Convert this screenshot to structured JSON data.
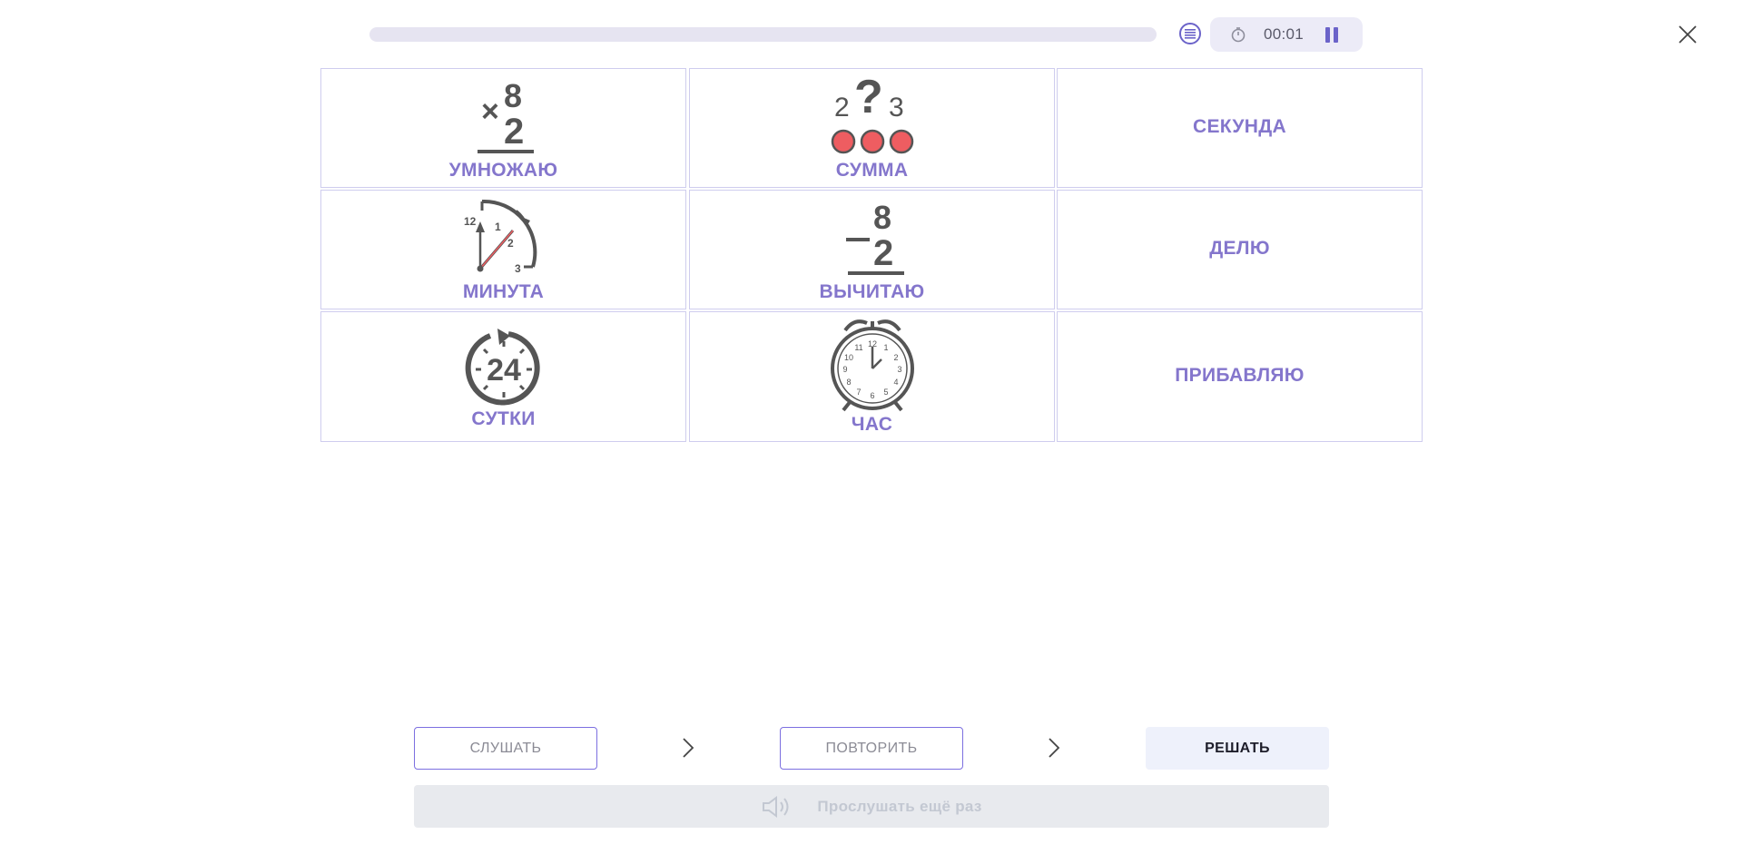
{
  "header": {
    "progress": 0,
    "timer": "00:01",
    "icons": {
      "list": "list-icon",
      "stopwatch": "stopwatch-icon",
      "pause": "pause-icon",
      "close": "close-icon"
    }
  },
  "cards": [
    {
      "label": "УМНОЖАЮ",
      "picture": "multiply-picture"
    },
    {
      "label": "СУММА",
      "picture": "sum-picture"
    },
    {
      "label": "СЕКУНДА",
      "picture": ""
    },
    {
      "label": "МИНУТА",
      "picture": "minute-clock-picture"
    },
    {
      "label": "ВЫЧИТАЮ",
      "picture": "subtract-picture"
    },
    {
      "label": "ДЕЛЮ",
      "picture": ""
    },
    {
      "label": "СУТКИ",
      "picture": "24-hours-picture"
    },
    {
      "label": "ЧАС",
      "picture": "alarm-clock-picture"
    },
    {
      "label": "ПРИБАВЛЯЮ",
      "picture": ""
    }
  ],
  "pictures": {
    "multiply": {
      "sign": "×",
      "top": "8",
      "bottom": "2"
    },
    "sum": {
      "left": "2",
      "mid": "?",
      "right": "3"
    },
    "minute": {
      "n12": "12",
      "n1": "1",
      "n2": "2",
      "n3": "3"
    },
    "subtract": {
      "sign": "−",
      "top": "8",
      "bottom": "2"
    },
    "day": {
      "num": "24"
    },
    "clock": [
      "12",
      "1",
      "2",
      "3",
      "4",
      "5",
      "6",
      "7",
      "8",
      "9",
      "10",
      "11"
    ]
  },
  "footer": {
    "listen_label": "СЛУШАТЬ",
    "repeat_label": "ПОВТОРИТЬ",
    "solve_label": "РЕШАТЬ",
    "listen_again_label": "Прослушать ещё раз"
  },
  "colors": {
    "accent": "#8476cc",
    "progress_track": "#e6e4f1",
    "dot_red": "#ee5d61",
    "icon_gray": "#555555"
  }
}
